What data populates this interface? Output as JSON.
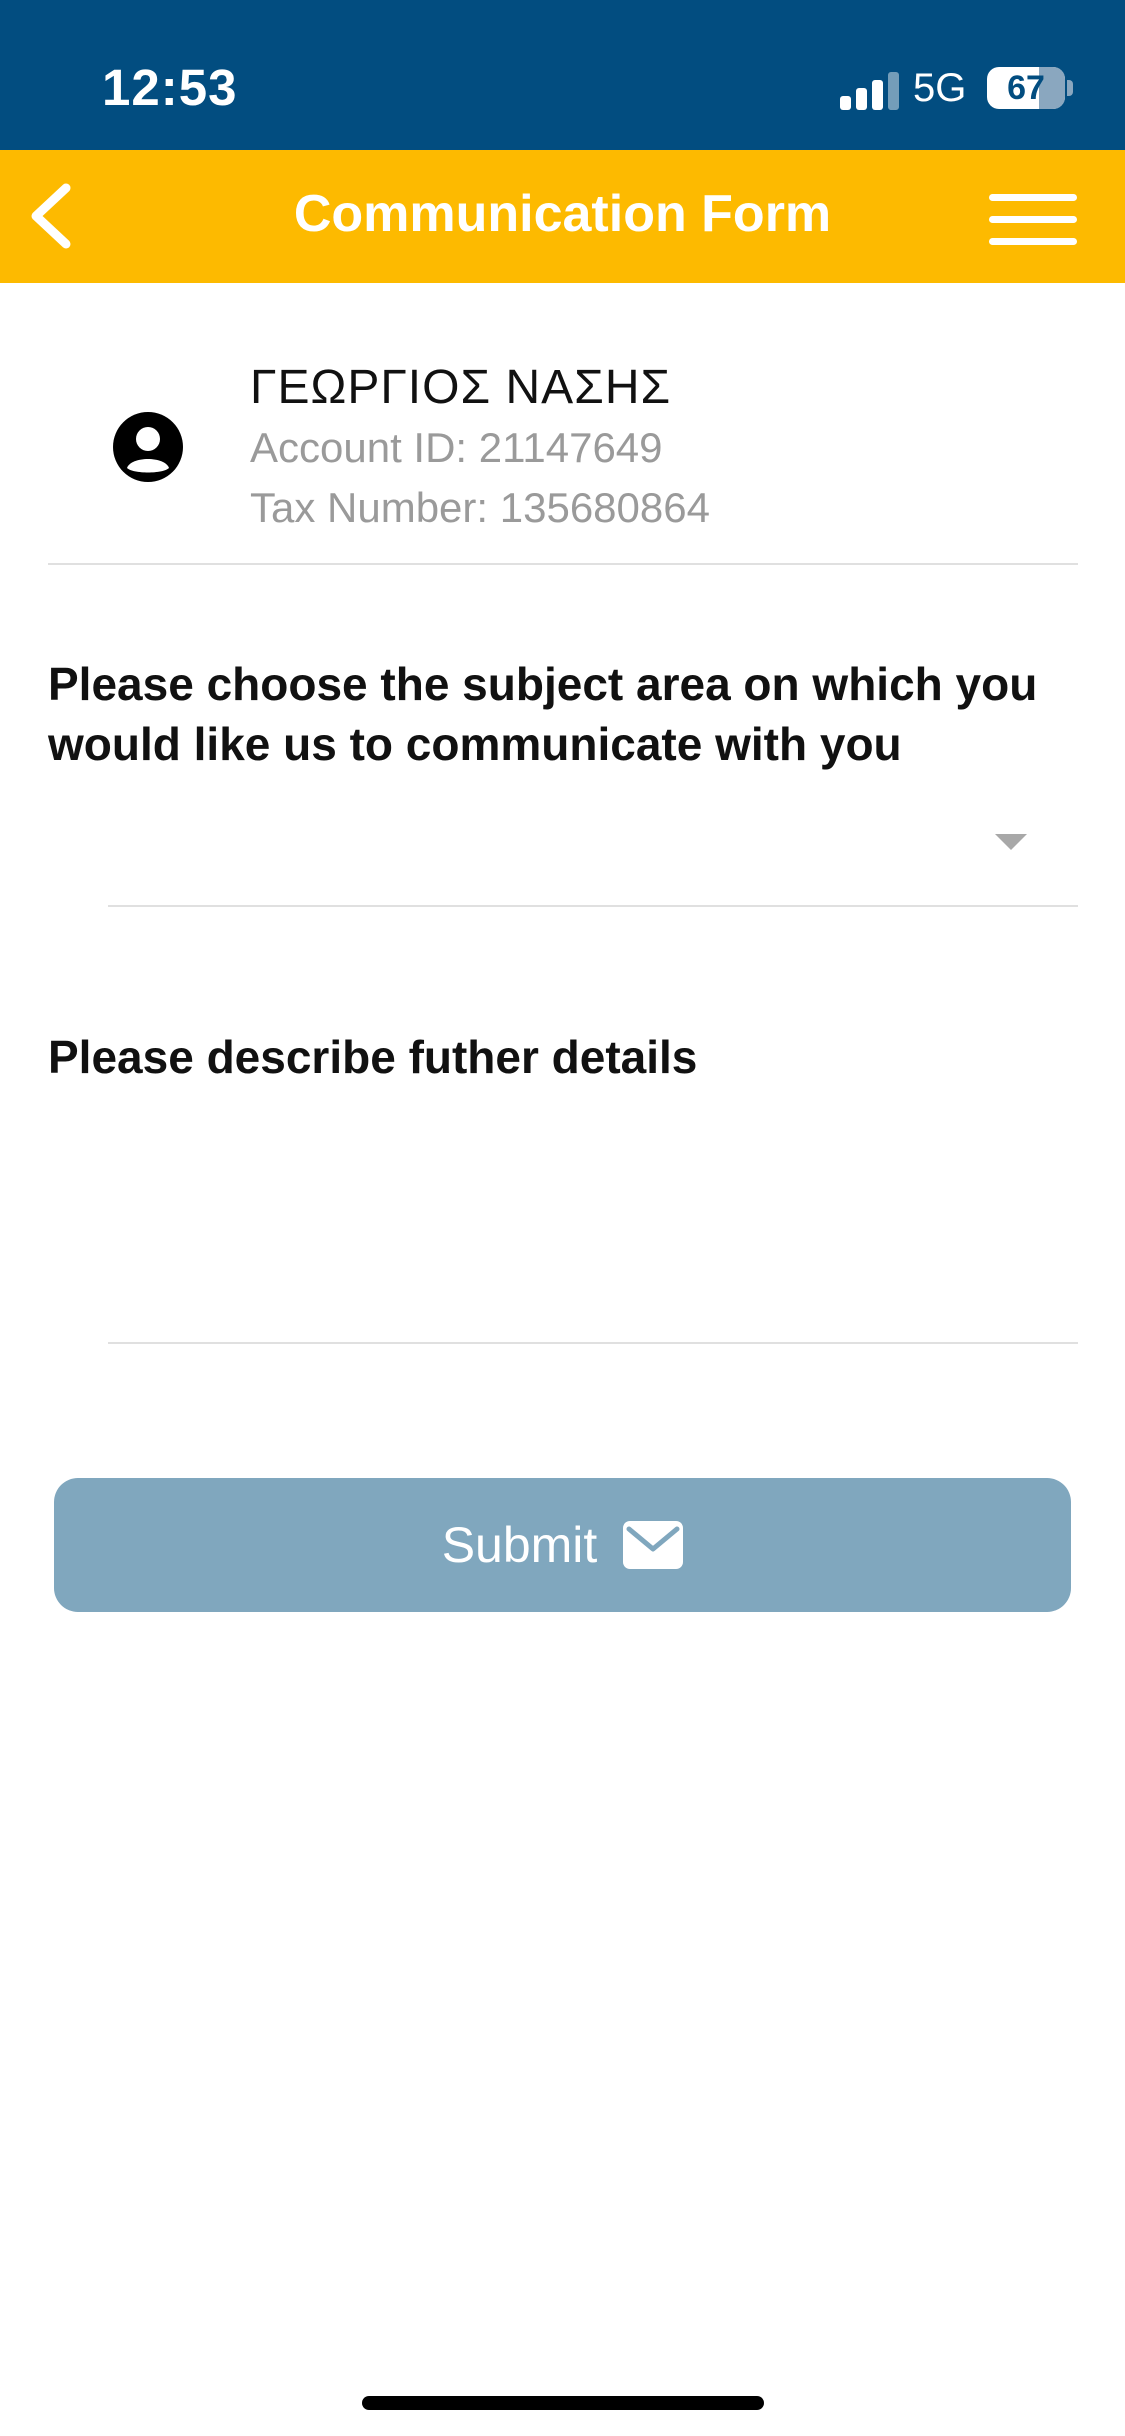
{
  "status_bar": {
    "time": "12:53",
    "network": "5G",
    "battery_level": "67",
    "battery_fraction": 0.67
  },
  "header": {
    "title": "Communication Form",
    "back_icon": "chevron-left-icon",
    "menu_icon": "hamburger-menu-icon"
  },
  "account": {
    "name": "ΓΕΩΡΓΙΟΣ ΝΑΣΗΣ",
    "account_id": "Account ID: 21147649",
    "tax_number": "Tax Number: 135680864",
    "avatar_icon": "user-circle-icon"
  },
  "form": {
    "subject_label": "Please choose the subject area on which you would like us to communicate with you",
    "subject_value": "",
    "details_label": "Please describe futher details",
    "details_value": "",
    "submit_label": "Submit",
    "submit_icon": "envelope-icon"
  },
  "colors": {
    "status_bar": "#024d80",
    "nav_bar": "#fdba00",
    "submit": "#80a7be"
  }
}
